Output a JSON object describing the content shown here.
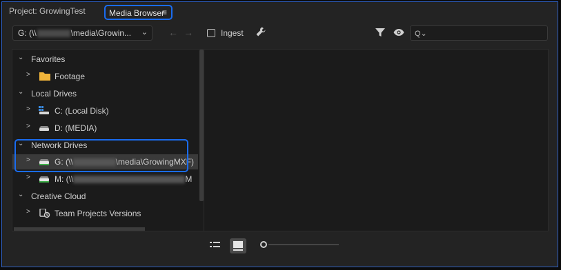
{
  "tabs": {
    "project": "Project: GrowingTest",
    "media": "Media Browser",
    "menu_glyph": "≡"
  },
  "toolbar": {
    "path_prefix": "G: (\\\\",
    "path_suffix": "\\media\\Growin...",
    "chevron": "⌄",
    "back_glyph": "←",
    "forward_glyph": "→",
    "ingest_label": "Ingest",
    "search_glyph": "Q⌄",
    "search_value": ""
  },
  "tree": {
    "favorites": {
      "label": "Favorites",
      "twisty": "⌄"
    },
    "footage": {
      "label": "Footage",
      "twisty": ">"
    },
    "local_drives": {
      "label": "Local Drives",
      "twisty": "⌄"
    },
    "c_drive": {
      "label": "C: (Local Disk)",
      "twisty": ">"
    },
    "d_drive": {
      "label": "D: (MEDIA)",
      "twisty": ">"
    },
    "network_drives": {
      "label": "Network Drives",
      "twisty": "⌄"
    },
    "g_drive": {
      "prefix": "G: (\\\\",
      "suffix": "\\media\\GrowingMXF)",
      "twisty": ">"
    },
    "m_drive": {
      "prefix": "M: (\\\\",
      "suffix": "M",
      "twisty": ">"
    },
    "creative_cloud": {
      "label": "Creative Cloud",
      "twisty": "⌄"
    },
    "team_projects": {
      "label": "Team Projects Versions",
      "twisty": ">"
    }
  },
  "colors": {
    "highlight": "#1a6cf0",
    "accent_green": "#3fb04a",
    "folder": "#f0b43a"
  },
  "bottom": {
    "list_view_icon": "list-view-icon",
    "icon_view_icon": "icon-view-icon",
    "zoom_level": 0.0
  }
}
